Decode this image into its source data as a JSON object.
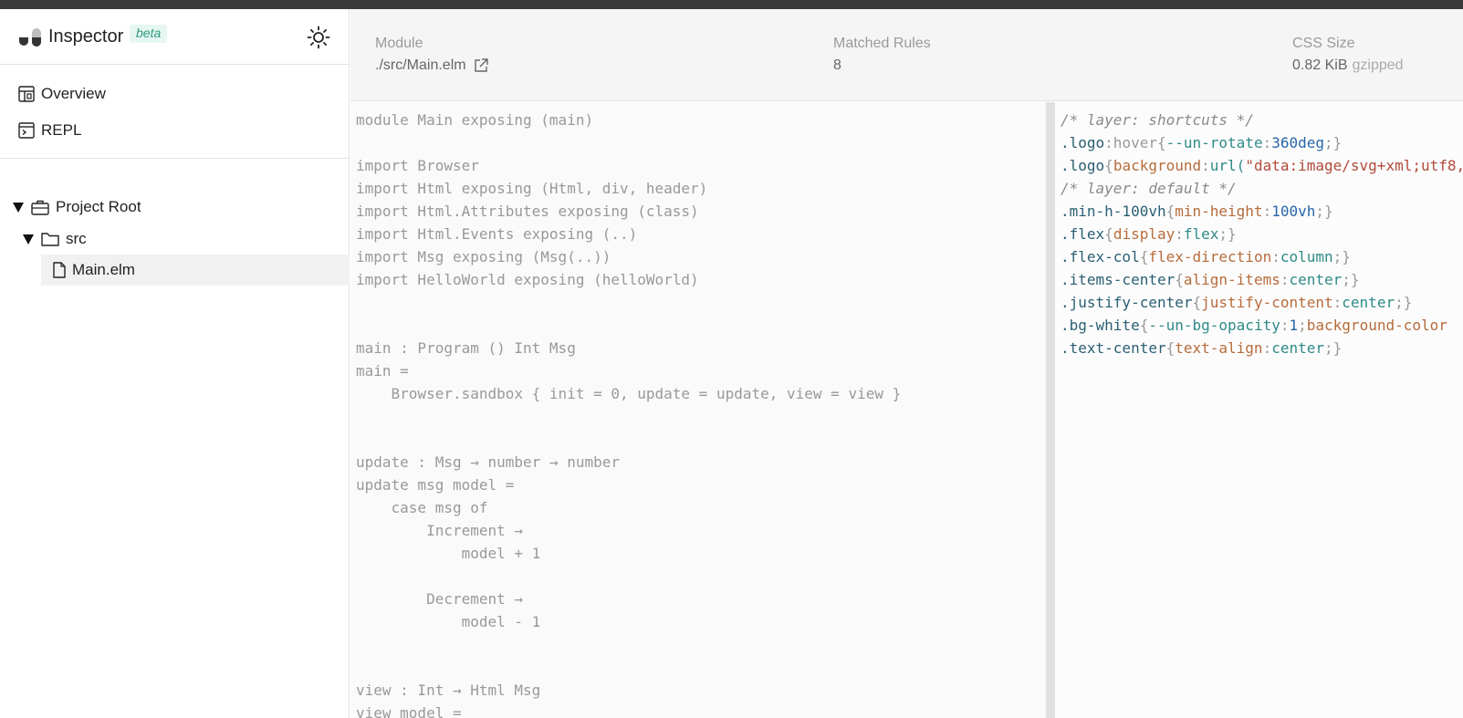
{
  "sidebar": {
    "app_title": "Inspector",
    "beta_badge": "beta",
    "nav": [
      {
        "label": "Overview",
        "icon": "dashboard-icon"
      },
      {
        "label": "REPL",
        "icon": "terminal-icon"
      }
    ],
    "tree": {
      "root": {
        "label": "Project Root",
        "icon": "briefcase-icon",
        "expanded": true
      },
      "folder": {
        "label": "src",
        "icon": "folder-icon",
        "expanded": true
      },
      "file": {
        "label": "Main.elm",
        "icon": "file-icon",
        "selected": true
      }
    }
  },
  "header": {
    "module": {
      "label": "Module",
      "value": "./src/Main.elm"
    },
    "rules": {
      "label": "Matched Rules",
      "value": "8"
    },
    "size": {
      "label": "CSS Size",
      "value": "0.82 KiB",
      "suffix": "gzipped"
    }
  },
  "source_code": [
    "module Main exposing (main)",
    "",
    "import Browser",
    "import Html exposing (Html, div, header)",
    "import Html.Attributes exposing (class)",
    "import Html.Events exposing (..)",
    "import Msg exposing (Msg(..))",
    "import HelloWorld exposing (helloWorld)",
    "",
    "",
    "main : Program () Int Msg",
    "main =",
    "    Browser.sandbox { init = 0, update = update, view = view }",
    "",
    "",
    "update : Msg → number → number",
    "update msg model =",
    "    case msg of",
    "        Increment →",
    "            model + 1",
    "",
    "        Decrement →",
    "            model - 1",
    "",
    "",
    "view : Int → Html Msg",
    "view model ="
  ],
  "css_output": [
    [
      {
        "t": "/* layer: shortcuts */",
        "k": "com"
      }
    ],
    [
      {
        "t": ".logo",
        "k": "sel"
      },
      {
        "t": ":hover{",
        "k": "pun"
      },
      {
        "t": "--un-rotate",
        "k": "val"
      },
      {
        "t": ":",
        "k": "pun"
      },
      {
        "t": "360deg",
        "k": "num"
      },
      {
        "t": ";}",
        "k": "pun"
      }
    ],
    [
      {
        "t": ".logo",
        "k": "sel"
      },
      {
        "t": "{",
        "k": "pun"
      },
      {
        "t": "background",
        "k": "prop"
      },
      {
        "t": ":",
        "k": "pun"
      },
      {
        "t": "url(",
        "k": "val"
      },
      {
        "t": "\"data:image/svg+xml;utf8,",
        "k": "str"
      }
    ],
    [
      {
        "t": "/* layer: default */",
        "k": "com"
      }
    ],
    [
      {
        "t": ".min-h-100vh",
        "k": "sel"
      },
      {
        "t": "{",
        "k": "pun"
      },
      {
        "t": "min-height",
        "k": "prop"
      },
      {
        "t": ":",
        "k": "pun"
      },
      {
        "t": "100vh",
        "k": "num"
      },
      {
        "t": ";}",
        "k": "pun"
      }
    ],
    [
      {
        "t": ".flex",
        "k": "sel"
      },
      {
        "t": "{",
        "k": "pun"
      },
      {
        "t": "display",
        "k": "prop"
      },
      {
        "t": ":",
        "k": "pun"
      },
      {
        "t": "flex",
        "k": "val"
      },
      {
        "t": ";}",
        "k": "pun"
      }
    ],
    [
      {
        "t": ".flex-col",
        "k": "sel"
      },
      {
        "t": "{",
        "k": "pun"
      },
      {
        "t": "flex-direction",
        "k": "prop"
      },
      {
        "t": ":",
        "k": "pun"
      },
      {
        "t": "column",
        "k": "val"
      },
      {
        "t": ";}",
        "k": "pun"
      }
    ],
    [
      {
        "t": ".items-center",
        "k": "sel"
      },
      {
        "t": "{",
        "k": "pun"
      },
      {
        "t": "align-items",
        "k": "prop"
      },
      {
        "t": ":",
        "k": "pun"
      },
      {
        "t": "center",
        "k": "val"
      },
      {
        "t": ";}",
        "k": "pun"
      }
    ],
    [
      {
        "t": ".justify-center",
        "k": "sel"
      },
      {
        "t": "{",
        "k": "pun"
      },
      {
        "t": "justify-content",
        "k": "prop"
      },
      {
        "t": ":",
        "k": "pun"
      },
      {
        "t": "center",
        "k": "val"
      },
      {
        "t": ";}",
        "k": "pun"
      }
    ],
    [
      {
        "t": ".bg-white",
        "k": "sel"
      },
      {
        "t": "{",
        "k": "pun"
      },
      {
        "t": "--un-bg-opacity",
        "k": "val"
      },
      {
        "t": ":",
        "k": "pun"
      },
      {
        "t": "1",
        "k": "num"
      },
      {
        "t": ";",
        "k": "pun"
      },
      {
        "t": "background-color",
        "k": "prop"
      }
    ],
    [
      {
        "t": ".text-center",
        "k": "sel"
      },
      {
        "t": "{",
        "k": "pun"
      },
      {
        "t": "text-align",
        "k": "prop"
      },
      {
        "t": ":",
        "k": "pun"
      },
      {
        "t": "center",
        "k": "val"
      },
      {
        "t": ";}",
        "k": "pun"
      }
    ]
  ],
  "colors": {
    "accent": "#2e9a7c",
    "header_bg": "#f5f5f6",
    "code_bg": "#fafafa"
  }
}
